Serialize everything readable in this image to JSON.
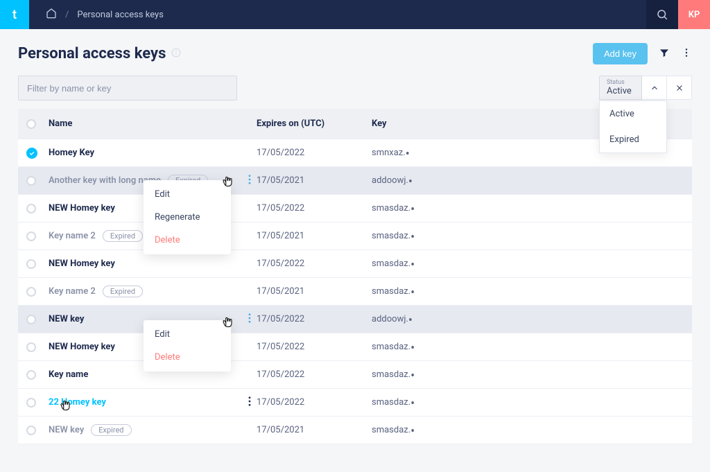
{
  "breadcrumb": {
    "current": "Personal access keys"
  },
  "user": {
    "initials": "KP"
  },
  "page": {
    "title": "Personal access keys"
  },
  "actions": {
    "add_key": "Add key"
  },
  "filter": {
    "placeholder": "Filter by name or key"
  },
  "status_filter": {
    "label": "Status",
    "value": "Active",
    "options": [
      "Active",
      "Expired"
    ]
  },
  "columns": {
    "name": "Name",
    "expires": "Expires on (UTC)",
    "key": "Key"
  },
  "badges": {
    "expired": "Expired"
  },
  "rows": [
    {
      "name": "Homey Key",
      "expires": "17/05/2022",
      "key": "smnxaz.",
      "checked": true,
      "expired": false,
      "highlighted": false
    },
    {
      "name": "Another key with long name",
      "expires": "17/05/2021",
      "key": "addoowj.",
      "checked": false,
      "expired": true,
      "highlighted": true,
      "more_blue": true
    },
    {
      "name": "NEW Homey key",
      "expires": "17/05/2022",
      "key": "smasdaz.",
      "checked": false,
      "expired": false,
      "highlighted": false
    },
    {
      "name": "Key name 2",
      "expires": "17/05/2021",
      "key": "smasdaz.",
      "checked": false,
      "expired": true,
      "highlighted": false
    },
    {
      "name": "NEW Homey key",
      "expires": "17/05/2022",
      "key": "smasdaz.",
      "checked": false,
      "expired": false,
      "highlighted": false
    },
    {
      "name": "Key name 2",
      "expires": "17/05/2021",
      "key": "smasdaz.",
      "checked": false,
      "expired": true,
      "highlighted": false
    },
    {
      "name": "NEW key",
      "expires": "17/05/2022",
      "key": "addoowj.",
      "checked": false,
      "expired": false,
      "highlighted": true,
      "more_blue": true
    },
    {
      "name": "NEW Homey key",
      "expires": "17/05/2022",
      "key": "smasdaz.",
      "checked": false,
      "expired": false,
      "highlighted": false
    },
    {
      "name": "Key name",
      "expires": "17/05/2022",
      "key": "smasdaz.",
      "checked": false,
      "expired": false,
      "highlighted": false
    },
    {
      "name": "22 Homey key",
      "expires": "17/05/2022",
      "key": "smasdaz.",
      "checked": false,
      "expired": false,
      "highlighted": false,
      "link": true,
      "more_black": true
    },
    {
      "name": "NEW key",
      "expires": "17/05/2021",
      "key": "smasdaz.",
      "checked": false,
      "expired": true,
      "highlighted": false
    }
  ],
  "context_menu_1": {
    "items": [
      {
        "label": "Edit",
        "danger": false
      },
      {
        "label": "Regenerate",
        "danger": false
      },
      {
        "label": "Delete",
        "danger": true
      }
    ]
  },
  "context_menu_2": {
    "items": [
      {
        "label": "Edit",
        "danger": false
      },
      {
        "label": "Delete",
        "danger": true
      }
    ]
  }
}
